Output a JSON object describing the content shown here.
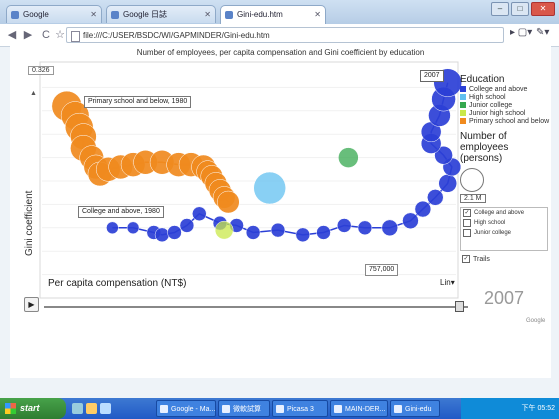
{
  "browser": {
    "tabs": [
      {
        "label": "Google"
      },
      {
        "label": "Google 日誌"
      },
      {
        "label": "Gini-edu.htm"
      }
    ],
    "url": "file:///C:/USER/BSDC/WI/GAPMINDER/Gini-edu.htm"
  },
  "page": {
    "title": "Number of employees, per capita compensation and Gini coefficient by education"
  },
  "chart": {
    "y_axis_label": "Gini coefficient",
    "y_top_value": "0.326",
    "x_axis_label": "Per capita compensation (NT$)",
    "x_scale": "Lin",
    "x_readout": "757,000",
    "year": "2007",
    "year_marker": "2007",
    "trail_labels": {
      "primary": "Primary school and below, 1980",
      "college": "College and above, 1980"
    },
    "brand": "Google"
  },
  "legend": {
    "title": "Education",
    "items": [
      {
        "label": "College and above",
        "color": "#2b3fd6"
      },
      {
        "label": "High school",
        "color": "#62c0f0"
      },
      {
        "label": "Junior college",
        "color": "#35a84f"
      },
      {
        "label": "Junior high school",
        "color": "#c9e84a"
      },
      {
        "label": "Primary school and below",
        "color": "#f08a1e"
      }
    ],
    "size_title": "Number of employees (persons)",
    "size_value": "2.1 M",
    "checklist": [
      {
        "label": "College and above",
        "checked": true
      },
      {
        "label": "High school",
        "checked": false
      },
      {
        "label": "Junior college",
        "checked": false
      }
    ],
    "trails_label": "Trails"
  },
  "chart_data": {
    "type": "scatter",
    "x_label": "Per capita compensation (NT$)",
    "y_label": "Gini coefficient",
    "series": [
      {
        "name": "Primary school and below",
        "color": "#f08a1e",
        "points": [
          [
            0.06,
            0.82
          ],
          [
            0.08,
            0.78
          ],
          [
            0.09,
            0.73
          ],
          [
            0.1,
            0.69
          ],
          [
            0.1,
            0.64
          ],
          [
            0.12,
            0.6
          ],
          [
            0.13,
            0.56
          ],
          [
            0.14,
            0.53
          ],
          [
            0.16,
            0.55
          ],
          [
            0.19,
            0.56
          ],
          [
            0.22,
            0.57
          ],
          [
            0.25,
            0.58
          ],
          [
            0.29,
            0.58
          ],
          [
            0.33,
            0.57
          ],
          [
            0.36,
            0.57
          ],
          [
            0.39,
            0.56
          ],
          [
            0.4,
            0.54
          ],
          [
            0.41,
            0.52
          ],
          [
            0.42,
            0.49
          ],
          [
            0.43,
            0.46
          ],
          [
            0.44,
            0.43
          ],
          [
            0.45,
            0.41
          ]
        ],
        "r": [
          15,
          14,
          14,
          13,
          13,
          12,
          12,
          12,
          12,
          12,
          12,
          12,
          12,
          12,
          12,
          12,
          11,
          11,
          11,
          11,
          11,
          11
        ]
      },
      {
        "name": "College and above",
        "color": "#2b3fd6",
        "points": [
          [
            0.17,
            0.3
          ],
          [
            0.22,
            0.3
          ],
          [
            0.27,
            0.28
          ],
          [
            0.29,
            0.27
          ],
          [
            0.32,
            0.28
          ],
          [
            0.35,
            0.31
          ],
          [
            0.38,
            0.36
          ],
          [
            0.43,
            0.32
          ],
          [
            0.47,
            0.31
          ],
          [
            0.51,
            0.28
          ],
          [
            0.57,
            0.29
          ],
          [
            0.63,
            0.27
          ],
          [
            0.68,
            0.28
          ],
          [
            0.73,
            0.31
          ],
          [
            0.78,
            0.3
          ],
          [
            0.84,
            0.3
          ],
          [
            0.89,
            0.33
          ],
          [
            0.92,
            0.38
          ],
          [
            0.95,
            0.43
          ],
          [
            0.98,
            0.49
          ],
          [
            0.99,
            0.56
          ],
          [
            0.97,
            0.61
          ],
          [
            0.94,
            0.66
          ],
          [
            0.94,
            0.71
          ],
          [
            0.96,
            0.78
          ],
          [
            0.97,
            0.85
          ],
          [
            0.98,
            0.92
          ]
        ],
        "r": [
          6,
          6,
          7,
          7,
          7,
          7,
          7,
          7,
          7,
          7,
          7,
          7,
          7,
          7,
          7,
          8,
          8,
          8,
          8,
          9,
          9,
          9,
          10,
          10,
          11,
          12,
          14
        ]
      },
      {
        "name": "High school",
        "color": "#62c0f0",
        "points": [
          [
            0.55,
            0.47
          ]
        ],
        "r": [
          16
        ]
      },
      {
        "name": "Junior college",
        "color": "#35a84f",
        "points": [
          [
            0.74,
            0.6
          ]
        ],
        "r": [
          10
        ]
      },
      {
        "name": "Junior high school",
        "color": "#c9e84a",
        "points": [
          [
            0.44,
            0.29
          ]
        ],
        "r": [
          9
        ]
      }
    ]
  },
  "taskbar": {
    "start": "start",
    "tasks": [
      "Google - Ma...",
      "微軟試算",
      "Picasa 3",
      "MAIN-DER...",
      "Gini-edu"
    ],
    "tray_time": "下午 05:52"
  }
}
